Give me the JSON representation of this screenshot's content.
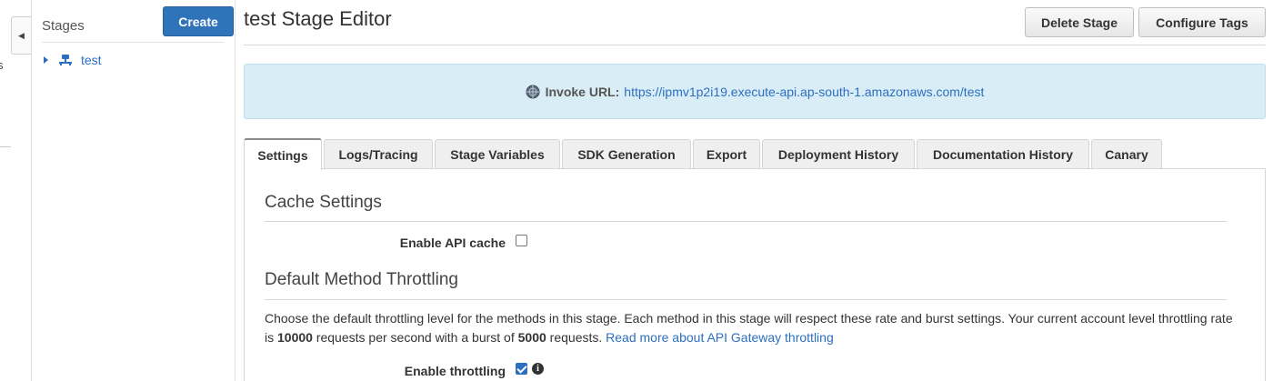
{
  "nav": {
    "fragment": "s"
  },
  "stages": {
    "title": "Stages",
    "create_label": "Create",
    "items": [
      {
        "label": "test"
      }
    ]
  },
  "editor": {
    "title": "test Stage Editor",
    "delete_label": "Delete Stage",
    "tags_label": "Configure Tags",
    "invoke_label": "Invoke URL:",
    "invoke_url": "https://ipmv1p2i19.execute-api.ap-south-1.amazonaws.com/test"
  },
  "tabs": [
    {
      "label": "Settings",
      "active": true
    },
    {
      "label": "Logs/Tracing"
    },
    {
      "label": "Stage Variables"
    },
    {
      "label": "SDK Generation"
    },
    {
      "label": "Export"
    },
    {
      "label": "Deployment History"
    },
    {
      "label": "Documentation History"
    },
    {
      "label": "Canary"
    }
  ],
  "settings": {
    "cache_title": "Cache Settings",
    "cache_label": "Enable API cache",
    "cache_checked": false,
    "throttle_title": "Default Method Throttling",
    "desc_part1": "Choose the default throttling level for the methods in this stage. Each method in this stage will respect these rate and burst settings. Your current account level throttling rate is ",
    "rate": "10000",
    "desc_part2": " requests per second with a burst of ",
    "burst": "5000",
    "desc_part3": " requests. ",
    "read_more": "Read more about API Gateway throttling",
    "throttle_label": "Enable throttling",
    "throttle_checked": true
  },
  "colors": {
    "primary": "#2f73b9",
    "link": "#2c6fbf",
    "info_bg": "#d9edf7"
  }
}
